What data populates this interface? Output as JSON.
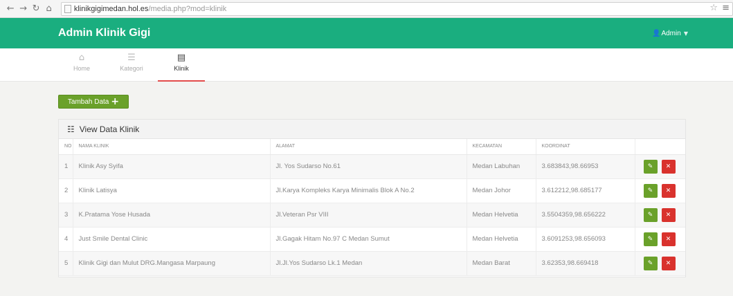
{
  "browser": {
    "url_host": "klinikgigimedan.hol.es",
    "url_path": "/media.php?mod=klinik",
    "back_icon": "arrow-left-icon",
    "forward_icon": "arrow-right-icon",
    "reload_icon": "reload-icon",
    "home_icon": "home-icon"
  },
  "navbar": {
    "brand": "Admin Klinik Gigi",
    "user_label": "Admin",
    "color": "#1aae7f"
  },
  "tabs": [
    {
      "label": "Home",
      "icon": "home-icon"
    },
    {
      "label": "Kategori",
      "icon": "list-icon"
    },
    {
      "label": "Klinik",
      "icon": "card-icon",
      "active": true
    }
  ],
  "toolbar": {
    "add_label": "Tambah Data"
  },
  "panel": {
    "title": "View Data Klinik"
  },
  "table": {
    "headers": [
      "NO",
      "NAMA KLINIK",
      "ALAMAT",
      "KECAMATAN",
      "KOORDINAT",
      ""
    ],
    "rows": [
      {
        "no": "1",
        "nama": "Klinik Asy Syifa",
        "alamat": "Jl. Yos Sudarso No.61",
        "kecamatan": "Medan Labuhan",
        "koordinat": "3.683843,98.66953"
      },
      {
        "no": "2",
        "nama": "Klinik Latisya",
        "alamat": "Jl.Karya Kompleks Karya Minimalis Blok A No.2",
        "kecamatan": "Medan Johor",
        "koordinat": "3.612212,98.685177"
      },
      {
        "no": "3",
        "nama": "K.Pratama Yose Husada",
        "alamat": "Jl.Veteran Psr VIII",
        "kecamatan": "Medan Helvetia",
        "koordinat": "3.5504359,98.656222"
      },
      {
        "no": "4",
        "nama": "Just Smile Dental Clinic",
        "alamat": "Jl.Gagak Hitam No.97 C Medan Sumut",
        "kecamatan": "Medan Helvetia",
        "koordinat": "3.6091253,98.656093"
      },
      {
        "no": "5",
        "nama": "Klinik Gigi dan Mulut DRG.Mangasa Marpaung",
        "alamat": "Jl.Jl.Yos Sudarso Lk.1 Medan",
        "kecamatan": "Medan Barat",
        "koordinat": "3.62353,98.669418"
      }
    ]
  },
  "colors": {
    "edit": "#6aa12a",
    "delete": "#d9322d",
    "active_tab_indicator": "#e24b4b"
  }
}
